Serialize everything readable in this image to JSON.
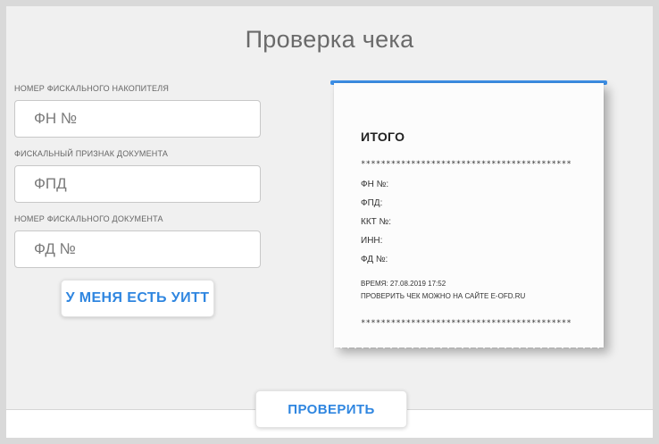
{
  "page": {
    "title": "Проверка чека"
  },
  "form": {
    "fn_label": "Номер фискального накопителя",
    "fn_placeholder": "ФН №",
    "fpd_label": "Фискальный признак документа",
    "fpd_placeholder": "ФПД",
    "fd_label": "Номер фискального документа",
    "fd_placeholder": "ФД №",
    "uitt_button": "У МЕНЯ ЕСТЬ УИТТ",
    "check_button": "ПРОВЕРИТЬ"
  },
  "receipt": {
    "total": "ИТОГО",
    "stars": "******************************************",
    "fn": "ФН №:",
    "fpd": "ФПД:",
    "kkt": "ККТ №:",
    "inn": "ИНН:",
    "fd": "ФД №:",
    "time": "Время: 27.08.2019 17:52",
    "site_note": "Проверить чек можно на сайте E-OFD.RU"
  },
  "colors": {
    "accent": "#2f86e0",
    "receipt_top": "#3d8fe6",
    "background": "#f0f0f0"
  }
}
